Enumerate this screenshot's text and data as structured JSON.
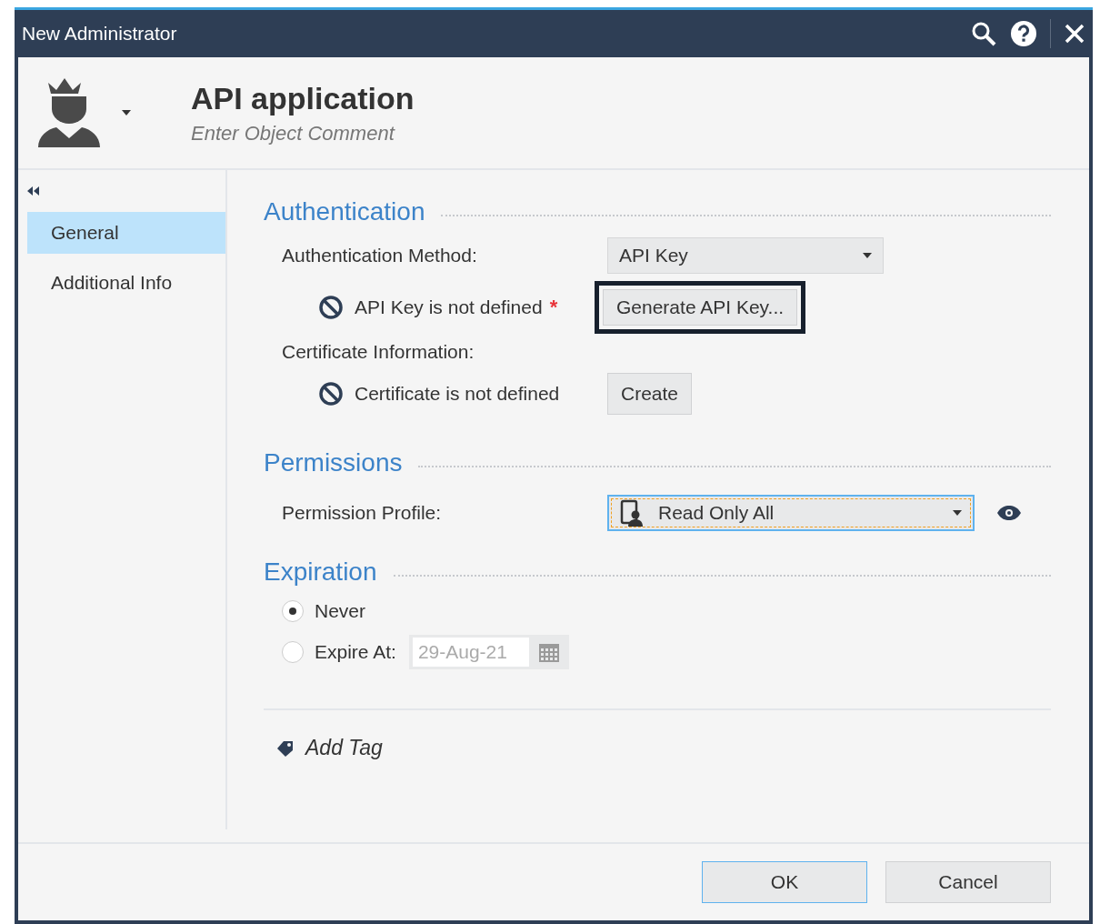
{
  "window": {
    "title": "New Administrator"
  },
  "header": {
    "name": "API application",
    "placeholder": "Enter Object Comment"
  },
  "sidebar": {
    "items": [
      {
        "label": "General",
        "selected": true
      },
      {
        "label": "Additional Info",
        "selected": false
      }
    ]
  },
  "authentication": {
    "title": "Authentication",
    "method_label": "Authentication Method:",
    "method_value": "API Key",
    "api_key_status": "API Key is not defined",
    "required_mark": "*",
    "generate_button": {
      "label": "Generate API Key...",
      "focused": true
    },
    "certificate_label": "Certificate Information:",
    "certificate_status": "Certificate is not defined",
    "create_button": {
      "label": "Create",
      "focused": false
    }
  },
  "permissions": {
    "title": "Permissions",
    "profile_label": "Permission Profile:",
    "profile_value": "Read Only All"
  },
  "expiration": {
    "title": "Expiration",
    "options": [
      {
        "label": "Never",
        "selected": true
      },
      {
        "label": "Expire At:",
        "selected": false
      }
    ],
    "date": {
      "value": "29-Aug-21",
      "disabled": true
    }
  },
  "add_tag": "Add Tag",
  "buttons": [
    {
      "label": "OK",
      "default": true
    },
    {
      "label": "Cancel",
      "default": false
    }
  ]
}
